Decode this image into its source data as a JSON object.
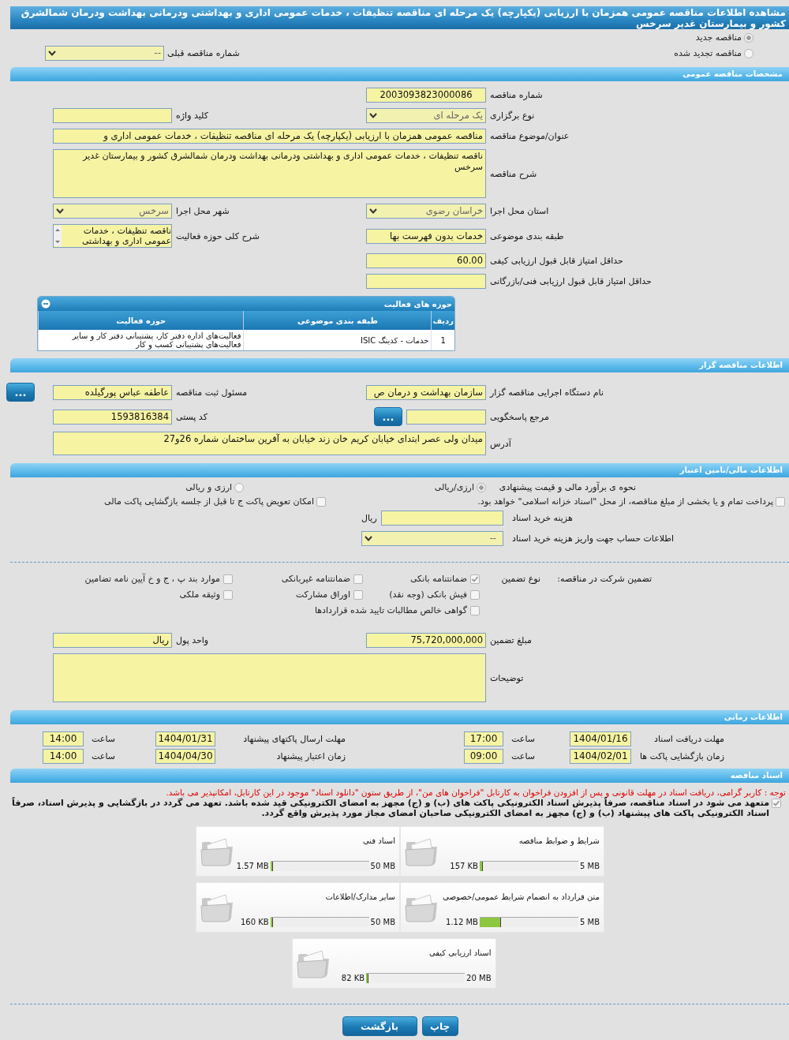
{
  "title": "مشاهده اطلاعات مناقصه عمومی همزمان با ارزیابی (یکپارچه) یک مرحله ای مناقصه تنظیفات ، خدمات عمومی اداری و بهداشتی ودرمانی بهداشت ودرمان شمالشرق کشور و بیمارستان غدیر سرخس",
  "tender_kind": {
    "options": [
      {
        "label": "مناقصه جدید",
        "selected": true
      },
      {
        "label": "مناقصه تجدید شده",
        "selected": false
      }
    ],
    "previous": {
      "label": "شماره مناقصه قبلی",
      "kind": "select",
      "value": "--"
    }
  },
  "general": {
    "heading": "مشخصات مناقصه عمومی",
    "rows": [
      [
        {
          "label": "شماره مناقصه",
          "kind": "code",
          "value": "2003093823000086"
        }
      ],
      [
        {
          "label": "نوع برگزاری",
          "kind": "select",
          "value": "یک مرحله ای"
        },
        {
          "label": "کلید واژه",
          "kind": "text"
        }
      ],
      [
        {
          "label": "عنوان/موضوع مناقصه",
          "kind": "wide",
          "value": "مناقصه عمومی همزمان با ارزیابی (یکپارچه) یک مرحله ای مناقصه تنظیفات ، خدمات عمومی اداری و"
        }
      ],
      [
        {
          "label": "شرح مناقصه",
          "kind": "area",
          "value": "ناقصه تنظیفات ، خدمات عمومی اداری و بهداشتی ودرمانی بهداشت ودرمان شمالشرق کشور و بیمارستان غدیر سرخس"
        }
      ],
      [
        {
          "label": "استان محل اجرا",
          "kind": "select",
          "value": "خراسان رضوی"
        },
        {
          "label": "شهر محل اجرا",
          "kind": "select",
          "value": "سرخس"
        }
      ],
      [
        {
          "label": "طبقه بندی موضوعی",
          "kind": "text",
          "value": "خدمات بدون فهرست بها"
        },
        {
          "label": "شرح کلی حوزه فعالیت",
          "kind": "list",
          "value": "ناقصه تنظیفات ، خدمات عمومی اداری و بهداشتی"
        }
      ],
      [
        {
          "label": "حداقل امتیاز قابل قبول ارزیابی کیفی",
          "kind": "number",
          "value": "60.00"
        }
      ],
      [
        {
          "label": "حداقل امتیاز قابل قبول ارزیابی فنی/بازرگانی",
          "kind": "number"
        }
      ]
    ],
    "activities": {
      "title": "حوزه های فعالیت",
      "columns": [
        "ردیف",
        "طبقه بندی موضوعی",
        "حوزه فعالیت"
      ],
      "rows": [
        [
          "1",
          "خدمات - کدینگ ISIC",
          "فعالیت‌های  اداره دفتر کار، پشتیبانی دفتر کار و سایر فعالیت‌های پشتیبانی کسب و کار"
        ]
      ]
    }
  },
  "organizer": {
    "heading": "اطلاعات مناقصه گزار",
    "rows": [
      [
        {
          "label": "نام دستگاه اجرایی مناقصه گزار",
          "kind": "text",
          "value": "سازمان بهداشت و درمان ص"
        },
        {
          "label": "مسئول ثبت مناقصه",
          "kind": "text",
          "value": "عاطفه عباس پورگیلده",
          "button": "..."
        }
      ],
      [
        {
          "label": "مرجع پاسخگویی",
          "kind": "text",
          "button": "..."
        },
        {
          "label": "کد پستی",
          "kind": "number",
          "value": "1593816384"
        }
      ],
      [
        {
          "label": "آدرس",
          "kind": "multiline",
          "value": "میدان ولی عصر ابتدای خیابان کریم خان زند خیابان به آفرین ساختمان شماره 26و27"
        }
      ]
    ]
  },
  "finance": {
    "heading": "اطلاعات مالی/تامین اعتبار",
    "estimate": {
      "label": "نحوه ی برآورد مالی و قیمت پیشنهادی",
      "options": [
        {
          "label": "ارزی/ریالی",
          "selected": true
        },
        {
          "label": "ارزی و ریالی",
          "selected": false
        }
      ]
    },
    "terms": [
      {
        "label": "پرداخت تمام و یا بخشی از مبلغ مناقصه، از محل \"اسناد خزانه اسلامی\" خواهد بود.",
        "checked": false
      },
      {
        "label": "امکان تعویض پاکت ج تا قبل از جلسه بازگشایی پاکت مالی",
        "checked": false
      }
    ],
    "costs": [
      {
        "label": "هزینه خرید اسناد",
        "kind": "number",
        "unit": "ریال"
      },
      {
        "label": "اطلاعات حساب جهت واریز هزینه خرید اسناد",
        "kind": "select",
        "value": "--"
      }
    ],
    "guarantee": {
      "label": "تضمین شرکت در مناقصه:",
      "type_label": "نوع تضمین",
      "options": [
        {
          "label": "ضمانتنامه بانکی",
          "checked": true
        },
        {
          "label": "ضمانتنامه غیربانکی",
          "checked": false
        },
        {
          "label": "موارد بند پ ، ج و خ آیین نامه تضامین",
          "checked": false
        },
        {
          "label": "فیش بانکی (وجه نقد)",
          "checked": false
        },
        {
          "label": "اوراق مشارکت",
          "checked": false
        },
        {
          "label": "وثیقه ملکی",
          "checked": false
        },
        {
          "label": "گواهی خالص مطالبات تایید شده قراردادها",
          "checked": false
        }
      ]
    },
    "rows": [
      [
        {
          "label": "مبلغ تضمین",
          "kind": "number",
          "value": "75,720,000,000"
        },
        {
          "label": "واحد پول",
          "kind": "text",
          "value": "ریال"
        }
      ],
      [
        {
          "label": "توضیحات",
          "kind": "area"
        }
      ]
    ]
  },
  "schedule": {
    "heading": "اطلاعات زمانی",
    "rows": [
      [
        {
          "label": "مهلت دریافت اسناد",
          "date": "1404/01/16",
          "time_label": "ساعت",
          "time": "17:00"
        },
        {
          "label": "مهلت ارسال پاکتهای پیشنهاد",
          "date": "1404/01/31",
          "time_label": "ساعت",
          "time": "14:00"
        }
      ],
      [
        {
          "label": "زمان بازگشایی پاکت ها",
          "date": "1404/02/01",
          "time_label": "ساعت",
          "time": "09:00"
        },
        {
          "label": "زمان اعتبار پیشنهاد",
          "date": "1404/04/30",
          "time_label": "ساعت",
          "time": "14:00"
        }
      ]
    ]
  },
  "documents": {
    "heading": "اسناد مناقصه",
    "notice": "توجه : کاربر گرامی، دریافت اسناد در مهلت قانونی و پس از افزودن فراخوان به کارتابل \"فراخوان های من\"، از طریق ستون \"دانلود اسناد\" موجود در این کارتابل، امکانپذیر می باشد.",
    "commitment": {
      "label": "متعهد می شود در اسناد مناقصه، صرفاً پذیرش اسناد الکترونیکی پاکت های (ب) و (ج) مجهز به امضای الکترونیکی قید شده باشد. تعهد می گردد در بازگشایی و پذیرش اسناد، صرفاً اسناد الکترونیکی پاکت های پیشنهاد (ب) و (ج) مجهز به امضای الکترونیکی صاحبان امضای مجاز مورد پذیرش واقع گردد.",
      "checked": true
    },
    "items": [
      {
        "title": "شرایط و ضوابط مناقصه",
        "used": "157 KB",
        "max": "5 MB",
        "level": 0.03
      },
      {
        "title": "اسناد فنی",
        "used": "1.57 MB",
        "max": "50 MB",
        "level": 0.03
      },
      {
        "title": "متن قرارداد به انضمام شرایط عمومی/خصوصی",
        "used": "1.12 MB",
        "max": "5 MB",
        "level": 0.22
      },
      {
        "title": "سایر مدارک/اطلاعات",
        "used": "160 KB",
        "max": "50 MB",
        "level": 0.01
      },
      {
        "title": "اسناد ارزیابی کیفی",
        "used": "82 KB",
        "max": "20 MB",
        "level": 0.01
      }
    ]
  },
  "buttons": [
    {
      "label": "چاپ"
    },
    {
      "label": "بازگشت"
    }
  ]
}
